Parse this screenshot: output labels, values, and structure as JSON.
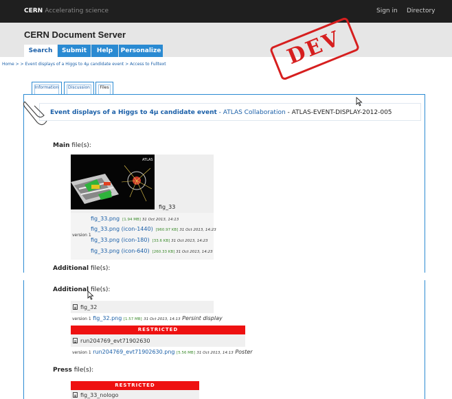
{
  "topbar": {
    "brand": "CERN",
    "tagline": "Accelerating science",
    "sign_in": "Sign in",
    "directory": "Directory"
  },
  "header": {
    "title": "CERN Document Server",
    "tabs": [
      "Search",
      "Submit",
      "Help",
      "Personalize"
    ]
  },
  "stamp": "DEV",
  "breadcrumb": "Home > > Event displays of a Higgs to 4μ candidate event > Access to Fulltext",
  "subtabs": [
    "Information",
    "Discussion",
    "Files"
  ],
  "record": {
    "title": "Event displays of a Higgs to 4μ candidate event",
    "sep1": " - ",
    "collab": "ATLAS Collaboration",
    "sep2": " - ",
    "id": "ATLAS-EVENT-DISPLAY-2012-005"
  },
  "main_section": {
    "bold": "Main",
    "rest": " file(s):"
  },
  "thumb": {
    "caption": "fig_33",
    "logo": "ATLAS"
  },
  "main_files": {
    "version": "version 1",
    "rows": [
      {
        "name": "fig_33.png",
        "size": "[1.94 MB]",
        "date": "31 Oct 2013, 14:13"
      },
      {
        "name": "fig_33.png (icon-1440)",
        "size": "[960.97 KB]",
        "date": "31 Oct 2013, 14:23"
      },
      {
        "name": "fig_33.png (icon-180)",
        "size": "[33.6 KB]",
        "date": "31 Oct 2013, 14:23"
      },
      {
        "name": "fig_33.png (icon-640)",
        "size": "[260.33 KB]",
        "date": "31 Oct 2013, 14:23"
      }
    ]
  },
  "additional1": {
    "bold": "Additional",
    "rest": " file(s):"
  },
  "additional2": {
    "bold": "Additional",
    "rest": " file(s):"
  },
  "add_files": [
    {
      "title": "fig_32",
      "version": "version 1",
      "name": "fig_32.png",
      "size": "[1.57 MB]",
      "date": "31 Oct 2013, 14:13",
      "desc": "Persint display"
    },
    {
      "restricted": "RESTRICTED",
      "title": "run204769_evt71902630",
      "version": "version 1",
      "name": "run204769_evt71902630.png",
      "size": "[5.56 MB]",
      "date": "31 Oct 2013, 14:13",
      "desc": "Poster"
    }
  ],
  "press": {
    "bold": "Press",
    "rest": " file(s):",
    "restricted": "RESTRICTED",
    "title": "fig_33_nologo"
  }
}
